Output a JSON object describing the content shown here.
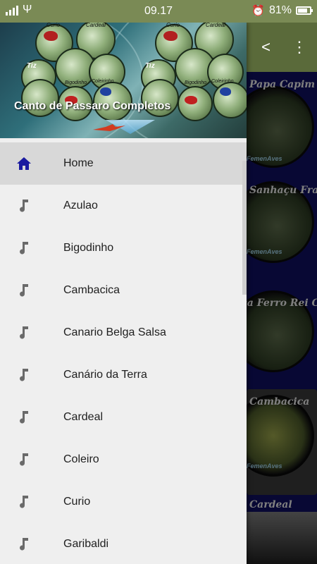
{
  "status_bar": {
    "time": "09.17",
    "battery_text": "81%",
    "battery_level": 0.81
  },
  "toolbar": {
    "icons": [
      "share-icon",
      "more-vert-icon"
    ]
  },
  "background_cards": [
    "Papa Capim",
    "Sanhaçu Frade",
    "Trinca Ferro Rei Cinza",
    "Cambacica",
    "Cardeal"
  ],
  "background_watermark": "FemenAves",
  "drawer": {
    "header_title": "Canto de Passaro Completos",
    "header_bird_labels": [
      "Curio",
      "Cardeal",
      "Tiz",
      "Bigodinho",
      "Coleirinho",
      "Curio",
      "Cardeal",
      "Tiz",
      "Bigodinho",
      "Coleirinho"
    ],
    "items": [
      {
        "label": "Home",
        "icon": "home-icon",
        "active": true
      },
      {
        "label": "Azulao",
        "icon": "music-note-icon",
        "active": false
      },
      {
        "label": "Bigodinho",
        "icon": "music-note-icon",
        "active": false
      },
      {
        "label": "Cambacica",
        "icon": "music-note-icon",
        "active": false
      },
      {
        "label": "Canario Belga Salsa",
        "icon": "music-note-icon",
        "active": false
      },
      {
        "label": "Canário da Terra",
        "icon": "music-note-icon",
        "active": false
      },
      {
        "label": "Cardeal",
        "icon": "music-note-icon",
        "active": false
      },
      {
        "label": "Coleiro",
        "icon": "music-note-icon",
        "active": false
      },
      {
        "label": "Curio",
        "icon": "music-note-icon",
        "active": false
      },
      {
        "label": "Garibaldi",
        "icon": "music-note-icon",
        "active": false
      }
    ]
  },
  "colors": {
    "status_bar": "#7a8a55",
    "toolbar": "#5a6a3a",
    "home_icon": "#1a1aa0",
    "note_icon": "#6a6a6a",
    "active_row": "#d8d8d8"
  }
}
